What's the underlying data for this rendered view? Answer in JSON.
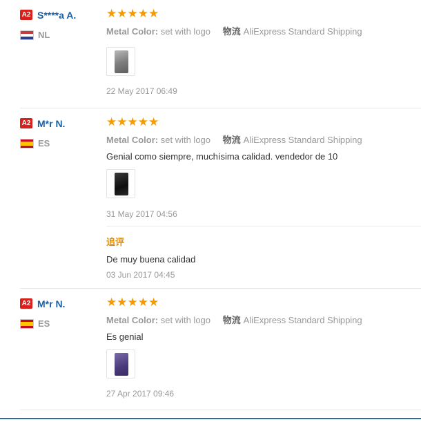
{
  "reviews": [
    {
      "level": "A2",
      "name": "S****a A.",
      "country": "NL",
      "stars": "★★★★★",
      "attr_key": "Metal Color:",
      "attr_val": "set with logo",
      "ship_key": "物流",
      "ship_val": "AliExpress Standard Shipping",
      "comment": "",
      "date": "22 May 2017 06:49"
    },
    {
      "level": "A2",
      "name": "M*r N.",
      "country": "ES",
      "stars": "★★★★★",
      "attr_key": "Metal Color:",
      "attr_val": "set with logo",
      "ship_key": "物流",
      "ship_val": "AliExpress Standard Shipping",
      "comment": "Genial como siempre, muchísima calidad. vendedor de 10",
      "date": "31 May 2017 04:56",
      "followup": {
        "title": "追评",
        "comment": "De muy buena calidad",
        "date": "03 Jun 2017 04:45"
      }
    },
    {
      "level": "A2",
      "name": "M*r N.",
      "country": "ES",
      "stars": "★★★★★",
      "attr_key": "Metal Color:",
      "attr_val": "set with logo",
      "ship_key": "物流",
      "ship_val": "AliExpress Standard Shipping",
      "comment": "Es genial",
      "date": "27 Apr 2017 09:46"
    }
  ]
}
